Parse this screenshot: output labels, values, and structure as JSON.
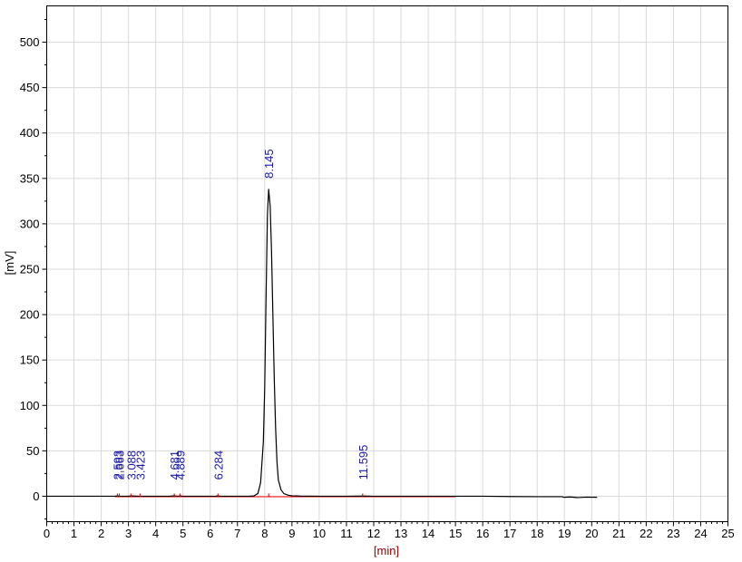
{
  "chart_data": {
    "type": "line",
    "xlabel": "[min]",
    "ylabel": "[mV]",
    "xlim": [
      0,
      25
    ],
    "ylim": [
      -28,
      540
    ],
    "x_ticks": [
      0,
      1,
      2,
      3,
      4,
      5,
      6,
      7,
      8,
      9,
      10,
      11,
      12,
      13,
      14,
      15,
      16,
      17,
      18,
      19,
      20,
      21,
      22,
      23,
      24,
      25
    ],
    "y_ticks": [
      0,
      50,
      100,
      150,
      200,
      250,
      300,
      350,
      400,
      450,
      500
    ],
    "grid": true,
    "series": [
      {
        "values_x": [
          0,
          2.5,
          2.6,
          2.7,
          3.0,
          3.1,
          3.4,
          3.5,
          4.5,
          4.68,
          4.8,
          4.89,
          5.0,
          6.2,
          6.28,
          6.4,
          7.4,
          7.6,
          7.75,
          7.85,
          7.95,
          8.0,
          8.05,
          8.1,
          8.145,
          8.2,
          8.25,
          8.3,
          8.35,
          8.4,
          8.45,
          8.5,
          8.6,
          8.7,
          8.85,
          9.0,
          9.3,
          10,
          11,
          11.6,
          12,
          13,
          14,
          15,
          16,
          17,
          18,
          18.9,
          19.0,
          19.2,
          19.5,
          19.8,
          20.2
        ],
        "values_y": [
          0,
          0,
          0.4,
          0,
          0,
          0.3,
          0,
          0,
          0,
          0.5,
          0,
          0.4,
          0,
          0,
          0.3,
          0,
          0,
          0.3,
          3,
          15,
          60,
          120,
          220,
          310,
          338,
          320,
          270,
          200,
          130,
          75,
          38,
          18,
          7,
          3,
          1.2,
          0.5,
          0.2,
          0,
          0,
          0.2,
          0,
          0,
          0,
          0,
          0,
          -0.3,
          -0.5,
          -0.5,
          -1.2,
          -0.8,
          -1.5,
          -1.0,
          -1.2
        ],
        "color": "#000000"
      }
    ],
    "baseline": {
      "x_start": 2.5,
      "x_end": 15.0,
      "color": "#ff0000"
    },
    "peaks": [
      {
        "rt": 2.593,
        "label": "2.593"
      },
      {
        "rt": 2.663,
        "label": "2.663"
      },
      {
        "rt": 3.088,
        "label": "3.088"
      },
      {
        "rt": 3.423,
        "label": "3.423"
      },
      {
        "rt": 4.681,
        "label": "4.681"
      },
      {
        "rt": 4.889,
        "label": "4.889"
      },
      {
        "rt": 6.284,
        "label": "6.284"
      },
      {
        "rt": 8.145,
        "label": "8.145",
        "height": 338
      },
      {
        "rt": 11.595,
        "label": "11.595"
      }
    ],
    "peak_label_color": "#1a1aa6",
    "baseline_label_y": 18,
    "apex_label_offset": 12
  }
}
